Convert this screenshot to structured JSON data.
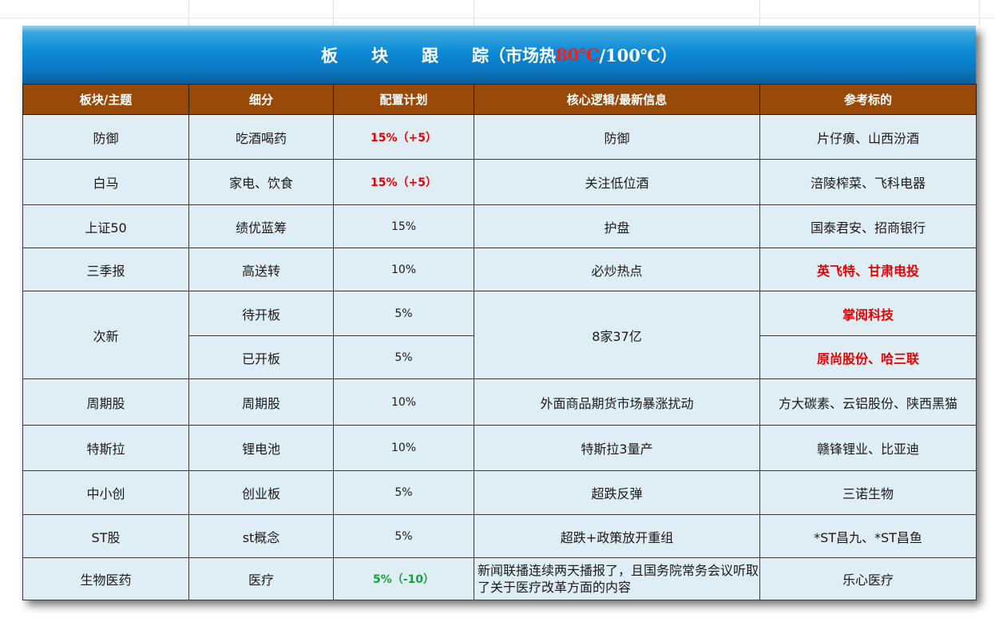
{
  "title": {
    "main": "板　　块　　跟　　踪",
    "paren_open": "（市场热",
    "heat": "80℃",
    "slash_max": "/100℃）"
  },
  "headers": [
    "板块/主题",
    "细分",
    "配置计划",
    "核心逻辑/最新信息",
    "参考标的"
  ],
  "rows": [
    {
      "sector": "防御",
      "sub": "吃酒喝药",
      "plan": "15%（+5）",
      "logic": "防御",
      "targets": "片仔癀、山西汾酒"
    },
    {
      "sector": "白马",
      "sub": "家电、饮食",
      "plan": "15%（+5）",
      "logic": "关注低位酒",
      "targets": "涪陵榨菜、飞科电器"
    },
    {
      "sector": "上证50",
      "sub": "绩优蓝筹",
      "plan": "15%",
      "logic": "护盘",
      "targets": "国泰君安、招商银行"
    },
    {
      "sector": "三季报",
      "sub": "高送转",
      "plan": "10%",
      "logic": "必炒热点",
      "targets": "英飞特、甘肃电投"
    },
    {
      "sector": "次新",
      "sub": "待开板",
      "plan": "5%",
      "logic": "8家37亿",
      "targets": "掌阅科技"
    },
    {
      "sub": "已开板",
      "plan": "5%",
      "targets": "原尚股份、哈三联"
    },
    {
      "sector": "周期股",
      "sub": "周期股",
      "plan": "10%",
      "logic": "外面商品期货市场暴涨扰动",
      "targets": "方大碳素、云铝股份、陕西黑猫"
    },
    {
      "sector": "特斯拉",
      "sub": "锂电池",
      "plan": "10%",
      "logic": "特斯拉3量产",
      "targets": "赣锋锂业、比亚迪"
    },
    {
      "sector": "中小创",
      "sub": "创业板",
      "plan": "5%",
      "logic": "超跌反弹",
      "targets": "三诺生物"
    },
    {
      "sector": "ST股",
      "sub": "st概念",
      "plan": "5%",
      "logic": "超跌+政策放开重组",
      "targets": "*ST昌九、*ST昌鱼"
    },
    {
      "sector": "生物医药",
      "sub": "医疗",
      "plan": "5%（-10）",
      "logic": "新闻联播连续两天播报了，且国务院常务会议听取了关于医疗改革方面的内容",
      "targets": "乐心医疗"
    }
  ],
  "colors": {
    "header_bg": "#9a4a08",
    "cell_bg": "#dfeef5",
    "title_blue": "#0d8ad6",
    "highlight_red": "#e60000",
    "highlight_green": "#1aa040"
  }
}
